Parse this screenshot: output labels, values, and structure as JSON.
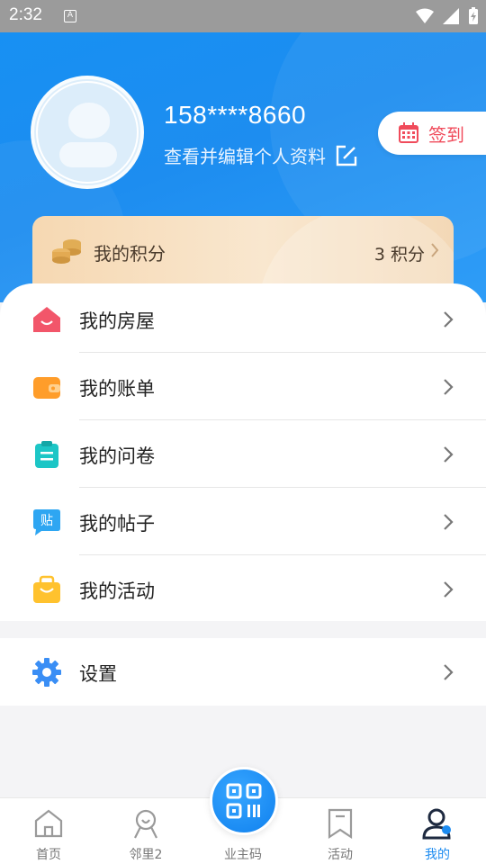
{
  "status_bar": {
    "time": "2:32",
    "notification_icon": "A"
  },
  "profile": {
    "phone": "158****8660",
    "edit_link": "查看并编辑个人资料",
    "sign_in": "签到"
  },
  "points": {
    "label": "我的积分",
    "value": "3 积分"
  },
  "menu": {
    "items": [
      {
        "label": "我的房屋",
        "icon": "house-icon",
        "color": "#f2566a"
      },
      {
        "label": "我的账单",
        "icon": "wallet-icon",
        "color": "#ff9d2a"
      },
      {
        "label": "我的问卷",
        "icon": "clipboard-icon",
        "color": "#1cc6c6"
      },
      {
        "label": "我的帖子",
        "icon": "post-icon",
        "color": "#2ea6f2"
      },
      {
        "label": "我的活动",
        "icon": "gift-bag-icon",
        "color": "#ffc22e"
      }
    ],
    "settings": {
      "label": "设置",
      "icon": "gear-icon",
      "color": "#3a8ef5"
    }
  },
  "bottom_nav": {
    "items": [
      {
        "label": "首页",
        "icon": "home-icon"
      },
      {
        "label": "邻里2",
        "icon": "community-icon"
      },
      {
        "label": "业主码",
        "icon": "qr-code-icon"
      },
      {
        "label": "活动",
        "icon": "bookmark-icon"
      },
      {
        "label": "我的",
        "icon": "profile-icon",
        "active": true
      }
    ]
  },
  "colors": {
    "primary": "#1c8bf0",
    "sign_in_red": "#f04b5b"
  }
}
